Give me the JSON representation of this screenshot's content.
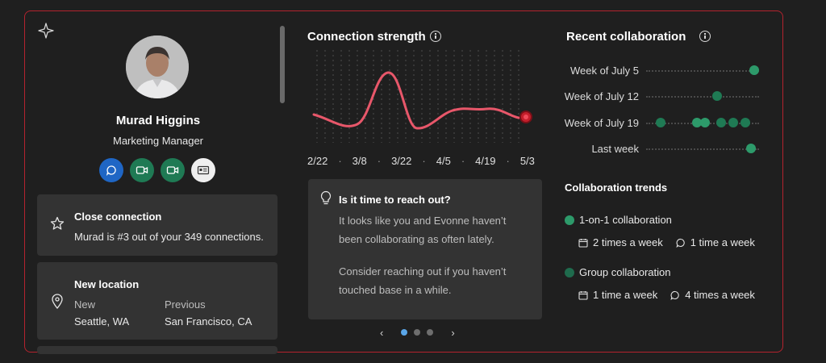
{
  "profile": {
    "name": "Murad Higgins",
    "title": "Marketing Manager"
  },
  "actions": [
    {
      "icon": "chat-icon"
    },
    {
      "icon": "video-icon"
    },
    {
      "icon": "video-icon"
    },
    {
      "icon": "contact-card-icon"
    }
  ],
  "close_connection": {
    "title": "Close connection",
    "text": "Murad is #3 out of your 349 connections."
  },
  "new_location": {
    "title": "New location",
    "new_label": "New",
    "new_value": "Seattle, WA",
    "previous_label": "Previous",
    "previous_value": "San Francisco, CA"
  },
  "connection_strength": {
    "title": "Connection strength",
    "x_labels": [
      "2/22",
      "3/8",
      "3/22",
      "4/5",
      "4/19",
      "5/3"
    ],
    "separator": "·"
  },
  "tip": {
    "title": "Is it time to reach out?",
    "line1": "It looks like you and Evonne haven’t",
    "line2": "been collaborating as often lately.",
    "line3": "Consider reaching out if you haven’t",
    "line4": "touched base in a while."
  },
  "pager": {
    "prev": "‹",
    "next": "›",
    "active_index": 0,
    "count": 3
  },
  "recent_collaboration": {
    "title": "Recent collaboration",
    "weeks": [
      "Week of July 5",
      "Week of July 12",
      "Week of July 19",
      "Last week"
    ]
  },
  "trends": {
    "title": "Collaboration trends",
    "one_on_one": {
      "label": "1-on-1 collaboration",
      "meetings": "2 times a week",
      "chats": "1 time a week"
    },
    "group": {
      "label": "Group collaboration",
      "meetings": "1 time a week",
      "chats": "4 times a week"
    }
  },
  "colors": {
    "accent_red": "#b4232e",
    "line_red": "#e8576a",
    "green": "#1f7a54",
    "blue": "#1f66c5"
  }
}
